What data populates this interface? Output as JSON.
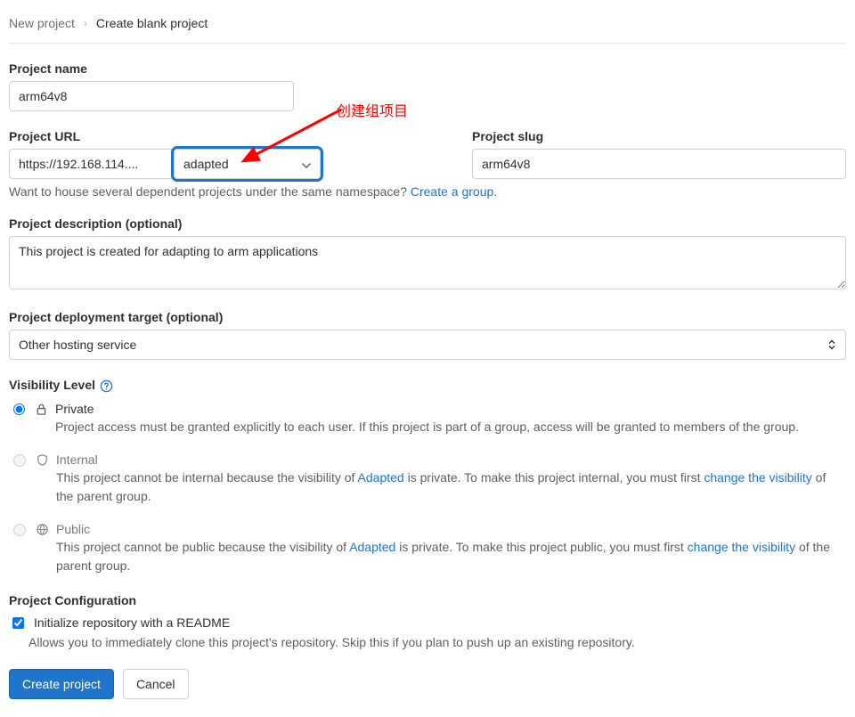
{
  "breadcrumb": {
    "root": "New project",
    "current": "Create blank project"
  },
  "project_name": {
    "label": "Project name",
    "value": "arm64v8"
  },
  "project_url": {
    "label": "Project URL",
    "prefix": "https://192.168.114....",
    "group_selected": "adapted"
  },
  "project_slug": {
    "label": "Project slug",
    "value": "arm64v8"
  },
  "namespace_helper": {
    "text": "Want to house several dependent projects under the same namespace? ",
    "link": "Create a group",
    "period": "."
  },
  "description": {
    "label": "Project description (optional)",
    "value": "This project is created for adapting to arm applications"
  },
  "deployment": {
    "label": "Project deployment target (optional)",
    "selected": "Other hosting service"
  },
  "visibility": {
    "label": "Visibility Level",
    "private": {
      "title": "Private",
      "desc": "Project access must be granted explicitly to each user. If this project is part of a group, access will be granted to members of the group."
    },
    "internal": {
      "title": "Internal",
      "desc_prefix": "This project cannot be internal because the visibility of ",
      "group_link": "Adapted",
      "desc_mid": " is private. To make this project internal, you must first ",
      "change_link": "change the visibility",
      "desc_suffix": " of the parent group."
    },
    "public": {
      "title": "Public",
      "desc_prefix": "This project cannot be public because the visibility of ",
      "group_link": "Adapted",
      "desc_mid": " is private. To make this project public, you must first ",
      "change_link": "change the visibility",
      "desc_suffix": " of the parent group."
    }
  },
  "config": {
    "label": "Project Configuration",
    "readme_label": "Initialize repository with a README",
    "readme_help": "Allows you to immediately clone this project's repository. Skip this if you plan to push up an existing repository."
  },
  "actions": {
    "create": "Create project",
    "cancel": "Cancel"
  },
  "annotation": {
    "text": "创建组项目"
  }
}
